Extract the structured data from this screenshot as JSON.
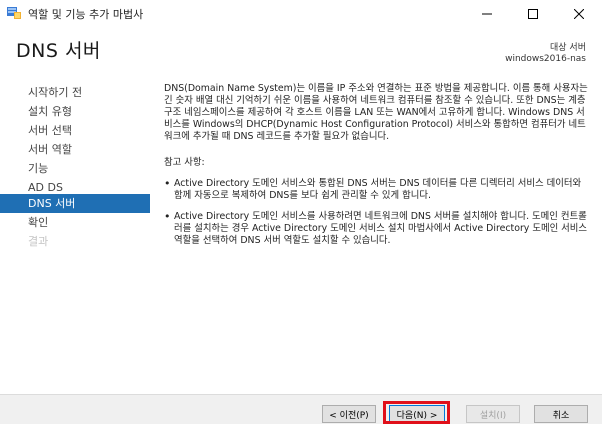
{
  "window": {
    "title": "역할 및 기능 추가 마법사"
  },
  "header": {
    "page_title": "DNS 서버",
    "target_label": "대상 서버",
    "target_server": "windows2016-nas"
  },
  "nav": {
    "items": [
      {
        "label": "시작하기 전",
        "state": "normal"
      },
      {
        "label": "설치 유형",
        "state": "normal"
      },
      {
        "label": "서버 선택",
        "state": "normal"
      },
      {
        "label": "서버 역할",
        "state": "normal"
      },
      {
        "label": "기능",
        "state": "normal"
      },
      {
        "label": "AD DS",
        "state": "normal"
      },
      {
        "label": "DNS 서버",
        "state": "active"
      },
      {
        "label": "확인",
        "state": "normal"
      },
      {
        "label": "결과",
        "state": "disabled"
      }
    ]
  },
  "content": {
    "intro": "DNS(Domain Name System)는 이름을 IP 주소와 연결하는 표준 방법을 제공합니다. 이름 통해 사용자는 긴 숫자 배열 대신 기억하기 쉬운 이름을 사용하여 네트워크 컴퓨터를 참조할 수 있습니다. 또한 DNS는 계층 구조 네임스페이스를 제공하여 각 호스트 이름을 LAN 또는 WAN에서 고유하게 합니다. Windows DNS 서비스를 Windows의 DHCP(Dynamic Host Configuration Protocol) 서비스와 통합하면 컴퓨터가 네트워크에 추가될 때 DNS 레코드를 추가할 필요가 없습니다.",
    "notes_label": "참고 사항:",
    "bullets": [
      "Active Directory 도메인 서비스와 통합된 DNS 서버는 DNS 데이터를 다른 디렉터리 서비스 데이터와 함께 자동으로 복제하여 DNS를 보다 쉽게 관리할 수 있게 합니다.",
      "Active Directory 도메인 서비스를 사용하려면 네트워크에 DNS 서버를 설치해야 합니다. 도메인 컨트롤러를 설치하는 경우 Active Directory 도메인 서비스 설치 마법사에서 Active Directory 도메인 서비스 역할을 선택하여 DNS 서버 역할도 설치할 수 있습니다."
    ]
  },
  "buttons": {
    "prev": "< 이전(P)",
    "next": "다음(N) >",
    "install": "설치(I)",
    "cancel": "취소"
  },
  "colors": {
    "nav_active": "#1f6fb4",
    "highlight": "#e0101a"
  }
}
